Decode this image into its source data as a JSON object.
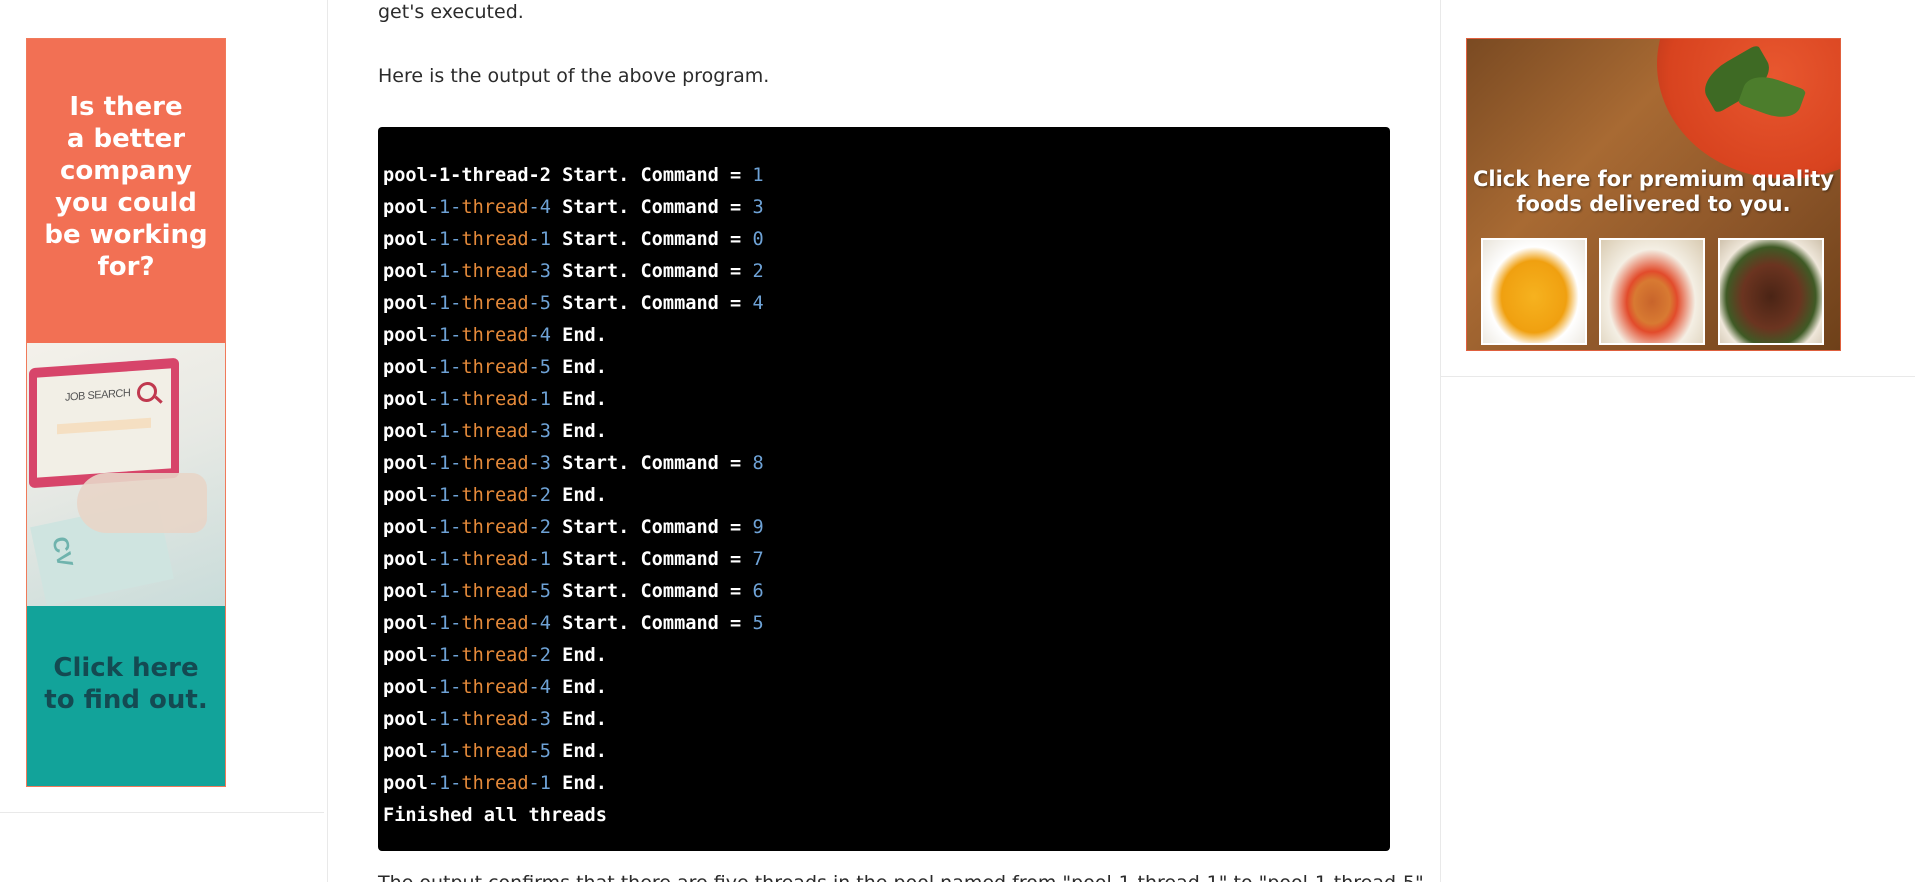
{
  "left_ad": {
    "headline": "Is there\na better\ncompany\nyou could\nbe working\nfor?",
    "image_text": "JOB SEARCH",
    "cv_mark": "CV",
    "cta": "Click here\nto find out."
  },
  "article": {
    "partial_line": "get's executed.",
    "intro_line": "Here is the output of the above program.",
    "bottom_partial": "The output confirms that there are five threads in the pool named from \"pool-1-thread-1\" to \"pool-1-thread-5\""
  },
  "code_output": [
    [
      {
        "t": "pool-1-thread-2 Start. Command = ",
        "c": "plain"
      },
      {
        "t": "1",
        "c": "num"
      }
    ],
    [
      {
        "t": "pool",
        "c": "plain"
      },
      {
        "t": "-1-",
        "c": "num"
      },
      {
        "t": "thread",
        "c": "kw"
      },
      {
        "t": "-4",
        "c": "num"
      },
      {
        "t": " Start. Command = ",
        "c": "plain"
      },
      {
        "t": "3",
        "c": "num"
      }
    ],
    [
      {
        "t": "pool",
        "c": "plain"
      },
      {
        "t": "-1-",
        "c": "num"
      },
      {
        "t": "thread",
        "c": "kw"
      },
      {
        "t": "-1",
        "c": "num"
      },
      {
        "t": " Start. Command = ",
        "c": "plain"
      },
      {
        "t": "0",
        "c": "num"
      }
    ],
    [
      {
        "t": "pool",
        "c": "plain"
      },
      {
        "t": "-1-",
        "c": "num"
      },
      {
        "t": "thread",
        "c": "kw"
      },
      {
        "t": "-3",
        "c": "num"
      },
      {
        "t": " Start. Command = ",
        "c": "plain"
      },
      {
        "t": "2",
        "c": "num"
      }
    ],
    [
      {
        "t": "pool",
        "c": "plain"
      },
      {
        "t": "-1-",
        "c": "num"
      },
      {
        "t": "thread",
        "c": "kw"
      },
      {
        "t": "-5",
        "c": "num"
      },
      {
        "t": " Start. Command = ",
        "c": "plain"
      },
      {
        "t": "4",
        "c": "num"
      }
    ],
    [
      {
        "t": "pool",
        "c": "plain"
      },
      {
        "t": "-1-",
        "c": "num"
      },
      {
        "t": "thread",
        "c": "kw"
      },
      {
        "t": "-4",
        "c": "num"
      },
      {
        "t": " End.",
        "c": "plain"
      }
    ],
    [
      {
        "t": "pool",
        "c": "plain"
      },
      {
        "t": "-1-",
        "c": "num"
      },
      {
        "t": "thread",
        "c": "kw"
      },
      {
        "t": "-5",
        "c": "num"
      },
      {
        "t": " End.",
        "c": "plain"
      }
    ],
    [
      {
        "t": "pool",
        "c": "plain"
      },
      {
        "t": "-1-",
        "c": "num"
      },
      {
        "t": "thread",
        "c": "kw"
      },
      {
        "t": "-1",
        "c": "num"
      },
      {
        "t": " End.",
        "c": "plain"
      }
    ],
    [
      {
        "t": "pool",
        "c": "plain"
      },
      {
        "t": "-1-",
        "c": "num"
      },
      {
        "t": "thread",
        "c": "kw"
      },
      {
        "t": "-3",
        "c": "num"
      },
      {
        "t": " End.",
        "c": "plain"
      }
    ],
    [
      {
        "t": "pool",
        "c": "plain"
      },
      {
        "t": "-1-",
        "c": "num"
      },
      {
        "t": "thread",
        "c": "kw"
      },
      {
        "t": "-3",
        "c": "num"
      },
      {
        "t": " Start. Command = ",
        "c": "plain"
      },
      {
        "t": "8",
        "c": "num"
      }
    ],
    [
      {
        "t": "pool",
        "c": "plain"
      },
      {
        "t": "-1-",
        "c": "num"
      },
      {
        "t": "thread",
        "c": "kw"
      },
      {
        "t": "-2",
        "c": "num"
      },
      {
        "t": " End.",
        "c": "plain"
      }
    ],
    [
      {
        "t": "pool",
        "c": "plain"
      },
      {
        "t": "-1-",
        "c": "num"
      },
      {
        "t": "thread",
        "c": "kw"
      },
      {
        "t": "-2",
        "c": "num"
      },
      {
        "t": " Start. Command = ",
        "c": "plain"
      },
      {
        "t": "9",
        "c": "num"
      }
    ],
    [
      {
        "t": "pool",
        "c": "plain"
      },
      {
        "t": "-1-",
        "c": "num"
      },
      {
        "t": "thread",
        "c": "kw"
      },
      {
        "t": "-1",
        "c": "num"
      },
      {
        "t": " Start. Command = ",
        "c": "plain"
      },
      {
        "t": "7",
        "c": "num"
      }
    ],
    [
      {
        "t": "pool",
        "c": "plain"
      },
      {
        "t": "-1-",
        "c": "num"
      },
      {
        "t": "thread",
        "c": "kw"
      },
      {
        "t": "-5",
        "c": "num"
      },
      {
        "t": " Start. Command = ",
        "c": "plain"
      },
      {
        "t": "6",
        "c": "num"
      }
    ],
    [
      {
        "t": "pool",
        "c": "plain"
      },
      {
        "t": "-1-",
        "c": "num"
      },
      {
        "t": "thread",
        "c": "kw"
      },
      {
        "t": "-4",
        "c": "num"
      },
      {
        "t": " Start. Command = ",
        "c": "plain"
      },
      {
        "t": "5",
        "c": "num"
      }
    ],
    [
      {
        "t": "pool",
        "c": "plain"
      },
      {
        "t": "-1-",
        "c": "num"
      },
      {
        "t": "thread",
        "c": "kw"
      },
      {
        "t": "-2",
        "c": "num"
      },
      {
        "t": " End.",
        "c": "plain"
      }
    ],
    [
      {
        "t": "pool",
        "c": "plain"
      },
      {
        "t": "-1-",
        "c": "num"
      },
      {
        "t": "thread",
        "c": "kw"
      },
      {
        "t": "-4",
        "c": "num"
      },
      {
        "t": " End.",
        "c": "plain"
      }
    ],
    [
      {
        "t": "pool",
        "c": "plain"
      },
      {
        "t": "-1-",
        "c": "num"
      },
      {
        "t": "thread",
        "c": "kw"
      },
      {
        "t": "-3",
        "c": "num"
      },
      {
        "t": " End.",
        "c": "plain"
      }
    ],
    [
      {
        "t": "pool",
        "c": "plain"
      },
      {
        "t": "-1-",
        "c": "num"
      },
      {
        "t": "thread",
        "c": "kw"
      },
      {
        "t": "-5",
        "c": "num"
      },
      {
        "t": " End.",
        "c": "plain"
      }
    ],
    [
      {
        "t": "pool",
        "c": "plain"
      },
      {
        "t": "-1-",
        "c": "num"
      },
      {
        "t": "thread",
        "c": "kw"
      },
      {
        "t": "-1",
        "c": "num"
      },
      {
        "t": " End.",
        "c": "plain"
      }
    ],
    [
      {
        "t": "Finished all threads",
        "c": "plain"
      }
    ]
  ],
  "right_ad": {
    "headline": "Click here for premium quality\nfoods delivered to you.",
    "images": [
      "macaroni-and-cheese",
      "chicken-vegetables-rice",
      "beef-pot-roast"
    ]
  },
  "colors": {
    "code_bg": "#000000",
    "code_number": "#6ea2d6",
    "code_keyword": "#e58a3a",
    "left_ad_top": "#f27054",
    "left_ad_bottom": "#12a39a"
  }
}
